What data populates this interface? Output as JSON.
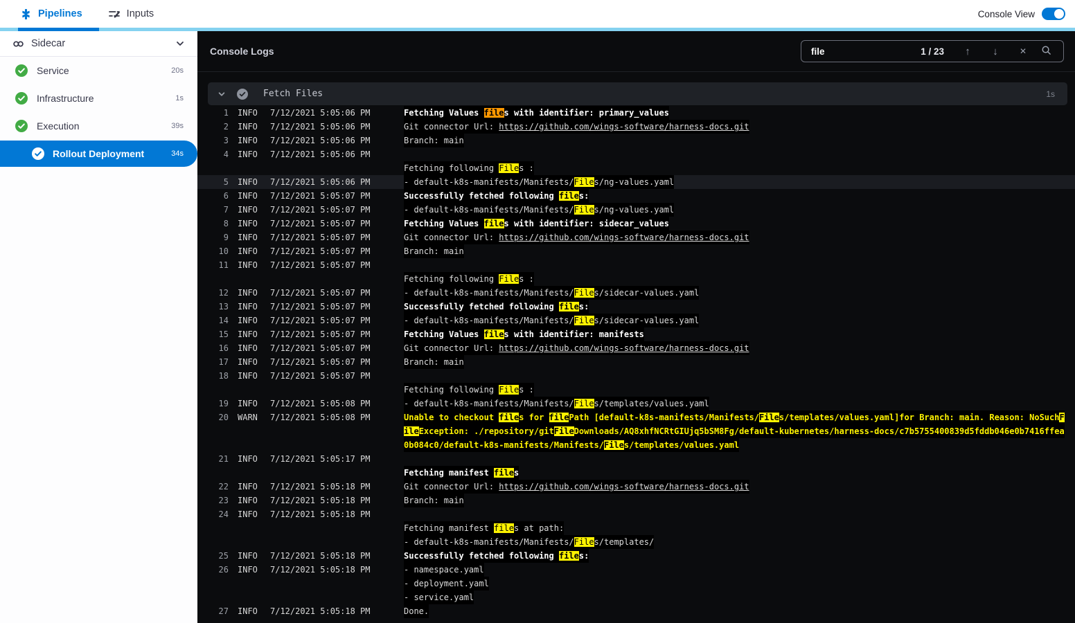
{
  "topbar": {
    "tabs": [
      {
        "label": "Pipelines",
        "active": true
      },
      {
        "label": "Inputs",
        "active": false
      }
    ],
    "toggle_label": "Console View",
    "toggle_state": "on"
  },
  "sidebar": {
    "title": "Sidecar",
    "items": [
      {
        "label": "Service",
        "duration": "20s",
        "status": "success"
      },
      {
        "label": "Infrastructure",
        "duration": "1s",
        "status": "success"
      },
      {
        "label": "Execution",
        "duration": "39s",
        "status": "success"
      },
      {
        "label": "Rollout Deployment",
        "duration": "34s",
        "status": "success",
        "selected": true
      }
    ]
  },
  "console": {
    "title": "Console Logs",
    "search": {
      "value": "file",
      "counter": "1 / 23",
      "icons": {
        "up": "↑",
        "down": "↓",
        "close": "✕"
      }
    },
    "section": {
      "title": "Fetch Files",
      "duration": "1s"
    },
    "logs": [
      {
        "n": "1",
        "level": "INFO",
        "time": "7/12/2021 5:05:06 PM",
        "lines": [
          {
            "bold": true,
            "seg": [
              [
                "Fetching Values "
              ],
              [
                "file",
                "cur"
              ],
              [
                "s with identifier: primary_values"
              ]
            ]
          }
        ]
      },
      {
        "n": "2",
        "level": "INFO",
        "time": "7/12/2021 5:05:06 PM",
        "lines": [
          {
            "seg": [
              [
                "Git connector Url: "
              ],
              [
                "https://github.com/wings-software/harness-docs.git",
                "link"
              ]
            ]
          }
        ]
      },
      {
        "n": "3",
        "level": "INFO",
        "time": "7/12/2021 5:05:06 PM",
        "lines": [
          {
            "seg": [
              [
                "Branch: main"
              ]
            ]
          }
        ]
      },
      {
        "n": "4",
        "level": "INFO",
        "time": "7/12/2021 5:05:06 PM",
        "lines": [
          {
            "seg": []
          },
          {
            "seg": [
              [
                "Fetching following "
              ],
              [
                "File",
                "m"
              ],
              [
                "s :"
              ]
            ]
          }
        ]
      },
      {
        "n": "5",
        "level": "INFO",
        "time": "7/12/2021 5:05:06 PM",
        "lines": [
          {
            "active": true,
            "seg": [
              [
                "- default-k8s-manifests/Manifests/"
              ],
              [
                "File",
                "m"
              ],
              [
                "s/ng-values.yaml"
              ]
            ]
          }
        ]
      },
      {
        "n": "6",
        "level": "INFO",
        "time": "7/12/2021 5:05:07 PM",
        "lines": [
          {
            "bold": true,
            "seg": [
              [
                "Successfully fetched following "
              ],
              [
                "file",
                "m"
              ],
              [
                "s:"
              ]
            ]
          }
        ]
      },
      {
        "n": "7",
        "level": "INFO",
        "time": "7/12/2021 5:05:07 PM",
        "lines": [
          {
            "seg": [
              [
                "- default-k8s-manifests/Manifests/"
              ],
              [
                "File",
                "m"
              ],
              [
                "s/ng-values.yaml"
              ]
            ]
          }
        ]
      },
      {
        "n": "8",
        "level": "INFO",
        "time": "7/12/2021 5:05:07 PM",
        "lines": [
          {
            "bold": true,
            "seg": [
              [
                "Fetching Values "
              ],
              [
                "file",
                "m"
              ],
              [
                "s with identifier: sidecar_values"
              ]
            ]
          }
        ]
      },
      {
        "n": "9",
        "level": "INFO",
        "time": "7/12/2021 5:05:07 PM",
        "lines": [
          {
            "seg": [
              [
                "Git connector Url: "
              ],
              [
                "https://github.com/wings-software/harness-docs.git",
                "link"
              ]
            ]
          }
        ]
      },
      {
        "n": "10",
        "level": "INFO",
        "time": "7/12/2021 5:05:07 PM",
        "lines": [
          {
            "seg": [
              [
                "Branch: main"
              ]
            ]
          }
        ]
      },
      {
        "n": "11",
        "level": "INFO",
        "time": "7/12/2021 5:05:07 PM",
        "lines": [
          {
            "seg": []
          },
          {
            "seg": [
              [
                "Fetching following "
              ],
              [
                "File",
                "m"
              ],
              [
                "s :"
              ]
            ]
          }
        ]
      },
      {
        "n": "12",
        "level": "INFO",
        "time": "7/12/2021 5:05:07 PM",
        "lines": [
          {
            "seg": [
              [
                "- default-k8s-manifests/Manifests/"
              ],
              [
                "File",
                "m"
              ],
              [
                "s/sidecar-values.yaml"
              ]
            ]
          }
        ]
      },
      {
        "n": "13",
        "level": "INFO",
        "time": "7/12/2021 5:05:07 PM",
        "lines": [
          {
            "bold": true,
            "seg": [
              [
                "Successfully fetched following "
              ],
              [
                "file",
                "m"
              ],
              [
                "s:"
              ]
            ]
          }
        ]
      },
      {
        "n": "14",
        "level": "INFO",
        "time": "7/12/2021 5:05:07 PM",
        "lines": [
          {
            "seg": [
              [
                "- default-k8s-manifests/Manifests/"
              ],
              [
                "File",
                "m"
              ],
              [
                "s/sidecar-values.yaml"
              ]
            ]
          }
        ]
      },
      {
        "n": "15",
        "level": "INFO",
        "time": "7/12/2021 5:05:07 PM",
        "lines": [
          {
            "bold": true,
            "seg": [
              [
                "Fetching Values "
              ],
              [
                "file",
                "m"
              ],
              [
                "s with identifier: manifests"
              ]
            ]
          }
        ]
      },
      {
        "n": "16",
        "level": "INFO",
        "time": "7/12/2021 5:05:07 PM",
        "lines": [
          {
            "seg": [
              [
                "Git connector Url: "
              ],
              [
                "https://github.com/wings-software/harness-docs.git",
                "link"
              ]
            ]
          }
        ]
      },
      {
        "n": "17",
        "level": "INFO",
        "time": "7/12/2021 5:05:07 PM",
        "lines": [
          {
            "seg": [
              [
                "Branch: main"
              ]
            ]
          }
        ]
      },
      {
        "n": "18",
        "level": "INFO",
        "time": "7/12/2021 5:05:07 PM",
        "lines": [
          {
            "seg": []
          },
          {
            "seg": [
              [
                "Fetching following "
              ],
              [
                "File",
                "m"
              ],
              [
                "s :"
              ]
            ]
          }
        ]
      },
      {
        "n": "19",
        "level": "INFO",
        "time": "7/12/2021 5:05:08 PM",
        "lines": [
          {
            "seg": [
              [
                "- default-k8s-manifests/Manifests/"
              ],
              [
                "File",
                "m"
              ],
              [
                "s/templates/values.yaml"
              ]
            ]
          }
        ]
      },
      {
        "n": "20",
        "level": "WARN",
        "time": "7/12/2021 5:05:08 PM",
        "lines": [
          {
            "warn": true,
            "seg": [
              [
                "Unable to checkout "
              ],
              [
                "file",
                "m"
              ],
              [
                "s for "
              ],
              [
                "file",
                "m"
              ],
              [
                "Path [default-k8s-manifests/Manifests/"
              ],
              [
                "File",
                "m"
              ],
              [
                "s/templates/values.yaml]for Branch: main. Reason: NoSuch"
              ],
              [
                "F",
                "m"
              ]
            ]
          },
          {
            "warn": true,
            "seg": [
              [
                "ile",
                "m"
              ],
              [
                "Exception: ./repository/git"
              ],
              [
                "File",
                "m"
              ],
              [
                "Downloads/AQ8xhfNCRtGIUjq5bSM8Fg/default-kubernetes/harness-docs/c7b5755400839d5fddb046e0b7416ffea"
              ]
            ]
          },
          {
            "warn": true,
            "seg": [
              [
                "0b084c0/default-k8s-manifests/Manifests/"
              ],
              [
                "File",
                "m"
              ],
              [
                "s/templates/values.yaml"
              ]
            ]
          }
        ]
      },
      {
        "n": "21",
        "level": "INFO",
        "time": "7/12/2021 5:05:17 PM",
        "lines": [
          {
            "seg": []
          },
          {
            "bold": true,
            "seg": [
              [
                "Fetching manifest "
              ],
              [
                "file",
                "m"
              ],
              [
                "s"
              ]
            ]
          }
        ]
      },
      {
        "n": "22",
        "level": "INFO",
        "time": "7/12/2021 5:05:18 PM",
        "lines": [
          {
            "seg": [
              [
                "Git connector Url: "
              ],
              [
                "https://github.com/wings-software/harness-docs.git",
                "link"
              ]
            ]
          }
        ]
      },
      {
        "n": "23",
        "level": "INFO",
        "time": "7/12/2021 5:05:18 PM",
        "lines": [
          {
            "seg": [
              [
                "Branch: main"
              ]
            ]
          }
        ]
      },
      {
        "n": "24",
        "level": "INFO",
        "time": "7/12/2021 5:05:18 PM",
        "lines": [
          {
            "seg": []
          },
          {
            "seg": [
              [
                "Fetching manifest "
              ],
              [
                "file",
                "m"
              ],
              [
                "s at path:"
              ]
            ]
          },
          {
            "seg": [
              [
                "- default-k8s-manifests/Manifests/"
              ],
              [
                "File",
                "m"
              ],
              [
                "s/templates/"
              ]
            ]
          }
        ]
      },
      {
        "n": "25",
        "level": "INFO",
        "time": "7/12/2021 5:05:18 PM",
        "lines": [
          {
            "bold": true,
            "seg": [
              [
                "Successfully fetched following "
              ],
              [
                "file",
                "m"
              ],
              [
                "s:"
              ]
            ]
          }
        ]
      },
      {
        "n": "26",
        "level": "INFO",
        "time": "7/12/2021 5:05:18 PM",
        "lines": [
          {
            "seg": [
              [
                "- namespace.yaml"
              ]
            ]
          },
          {
            "seg": [
              [
                "- deployment.yaml"
              ]
            ]
          },
          {
            "seg": [
              [
                "- service.yaml"
              ]
            ]
          }
        ]
      },
      {
        "n": "27",
        "level": "INFO",
        "time": "7/12/2021 5:05:18 PM",
        "lines": [
          {
            "seg": [
              [
                "Done."
              ]
            ]
          }
        ]
      }
    ]
  },
  "colors": {
    "accent_blue": "#0278d5",
    "strip_cyan": "#85d2f0",
    "success_green": "#42ab45",
    "warn_yellow": "#fdf200",
    "match_highlight": "#fdf200",
    "current_match_highlight": "#ff9800",
    "console_background": "#0b0c0e"
  }
}
